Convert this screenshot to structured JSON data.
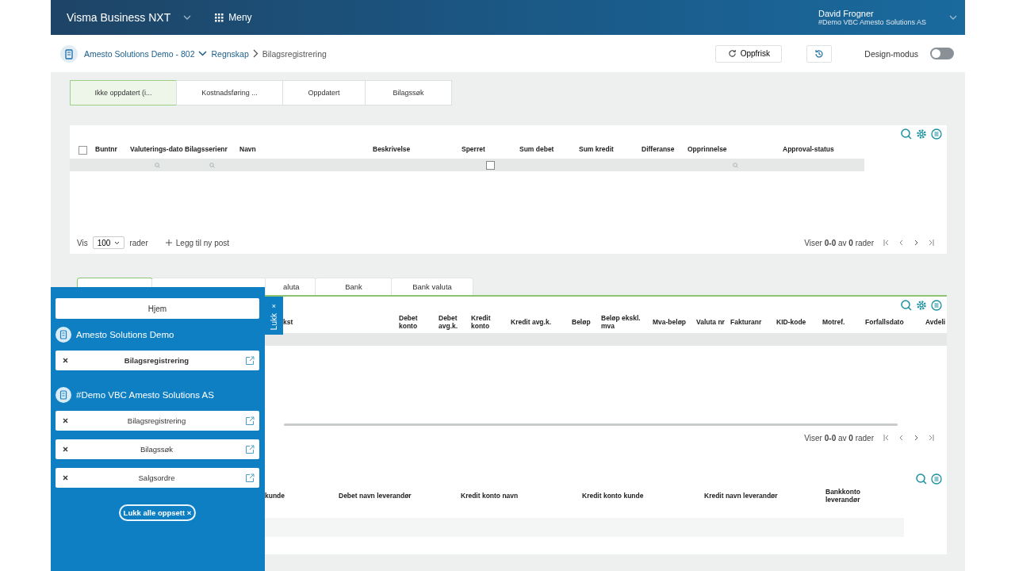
{
  "header": {
    "app_name": "Visma Business NXT",
    "menu_label": "Meny",
    "user_name": "David Frogner",
    "user_company": "#Demo VBC Amesto Solutions AS"
  },
  "breadcrumb": {
    "items": [
      "Amesto Solutions Demo - 802",
      "Regnskap",
      "Bilagsregistrering"
    ],
    "refresh_label": "Oppfrisk",
    "design_mode_label": "Design-modus",
    "design_mode_on": false
  },
  "top_tabs": [
    {
      "label": "Ikke oppdatert (i...",
      "selected": true
    },
    {
      "label": "Kostnadsføring ...",
      "selected": false
    },
    {
      "label": "Oppdatert",
      "selected": false
    },
    {
      "label": "Bilagssøk",
      "selected": false
    }
  ],
  "batch_table": {
    "select_all_checked": false,
    "columns": [
      {
        "label": "Buntnr"
      },
      {
        "label": "Valuterings-dato",
        "kind": "search"
      },
      {
        "label": "Bilagsserienr",
        "kind": "search"
      },
      {
        "label": "Navn"
      },
      {
        "label": "Beskrivelse"
      },
      {
        "label": "Sperret",
        "kind": "checkbox",
        "checked": false
      },
      {
        "label": "Sum debet"
      },
      {
        "label": "Sum kredit"
      },
      {
        "label": "Differanse"
      },
      {
        "label": "Opprinnelse",
        "kind": "search"
      },
      {
        "label": "Approval-status"
      }
    ],
    "pager": {
      "show_label": "Vis",
      "page_size": "100",
      "rows_label": "rader",
      "add_label": "Legg til ny post",
      "summary": "Viser **0-0** av **0** rader"
    }
  },
  "line_tabs": [
    {
      "selected": true
    },
    {
      "selected": false
    },
    {
      "label": "aluta",
      "selected": false
    },
    {
      "label": "Bank",
      "selected": false
    },
    {
      "label": "Bank valuta",
      "selected": false
    }
  ],
  "line_table": {
    "columns": [
      "kst",
      "Debet konto",
      "Debet avg.k.",
      "Kredit konto",
      "Kredit avg.k.",
      "Beløp",
      "Beløp ekskl. mva",
      "Mva-beløp",
      "Valuta nr",
      "Fakturanr",
      "KID-kode",
      "Motref.",
      "Forfallsdato",
      "Avdeli"
    ],
    "pager": {
      "summary": "Viser **0-0** av **0** rader"
    }
  },
  "detail_table": {
    "columns": [
      "kunde",
      "Debet navn leverandør",
      "Kredit konto navn",
      "Kredit konto kunde",
      "Kredit navn leverandør",
      "Bankkonto leverandør"
    ]
  },
  "layouts_panel": {
    "close_tab_label": "Lukk",
    "close_tab_icon": "×",
    "home_label": "Hjem",
    "groups": [
      {
        "company": "Amesto Solutions Demo",
        "items": [
          {
            "label": "Bilagsregistrering",
            "selected": true
          }
        ]
      },
      {
        "company": "#Demo VBC Amesto Solutions AS",
        "items": [
          {
            "label": "Bilagsregistrering",
            "selected": false
          },
          {
            "label": "Bilagssøk",
            "selected": false
          },
          {
            "label": "Salgsordre",
            "selected": false
          }
        ]
      }
    ],
    "close_all_label": "Lukk alle oppsett ×"
  }
}
